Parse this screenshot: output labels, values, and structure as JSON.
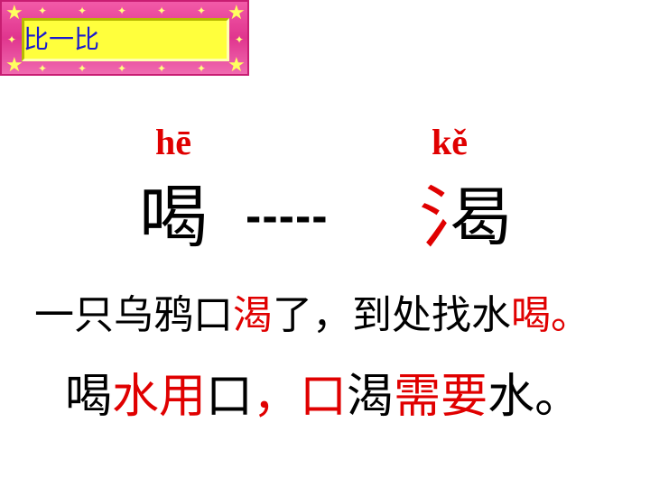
{
  "title": "比一比",
  "pinyin": {
    "left": "hē",
    "right": "kě"
  },
  "comparison": {
    "left_char": "喝",
    "dashes": "-----",
    "right_char_radical": "氵",
    "right_char_rest": "曷",
    "right_char": "渴"
  },
  "sentence1": {
    "seg1": "一只乌鸦口",
    "seg2": "渴",
    "seg3": "了，到处找水",
    "seg4": "喝",
    "seg5": "。"
  },
  "sentence2": {
    "seg1": "喝",
    "seg2": "水用",
    "seg3": "口",
    "seg4": "，口",
    "seg5": "渴",
    "seg6": "需要",
    "seg7": "水。"
  },
  "colors": {
    "highlight": "#e00000",
    "title_text": "#1a1ad0",
    "frame": "#e0358e",
    "frame_inner": "#ffff3c"
  },
  "icons": [
    "star-icon"
  ]
}
